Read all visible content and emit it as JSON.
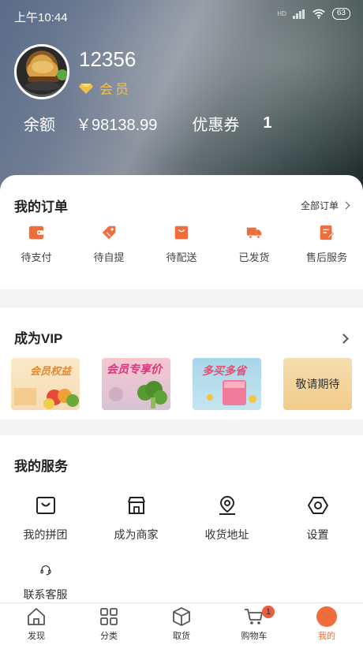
{
  "status_bar": {
    "time": "上午10:44",
    "battery": "63",
    "network": "HD"
  },
  "profile": {
    "username": "12356",
    "member_label": "会员"
  },
  "balance": {
    "label": "余额",
    "value": "￥98138.99",
    "coupon_label": "优惠券",
    "coupon_value": "1"
  },
  "orders": {
    "title": "我的订单",
    "all_label": "全部订单",
    "items": [
      {
        "label": "待支付",
        "icon": "wallet-icon"
      },
      {
        "label": "待自提",
        "icon": "tag-icon"
      },
      {
        "label": "待配送",
        "icon": "bag-icon"
      },
      {
        "label": "已发货",
        "icon": "truck-icon"
      },
      {
        "label": "售后服务",
        "icon": "document-edit-icon"
      }
    ]
  },
  "vip": {
    "title": "成为VIP",
    "cards": [
      {
        "label": "会员权益"
      },
      {
        "label": "会员专享价"
      },
      {
        "label": "多买多省"
      },
      {
        "label": "敬请期待"
      }
    ]
  },
  "services": {
    "title": "我的服务",
    "items": [
      {
        "label": "我的拼团",
        "icon": "group-buy-icon"
      },
      {
        "label": "成为商家",
        "icon": "store-icon"
      },
      {
        "label": "收货地址",
        "icon": "location-icon"
      },
      {
        "label": "设置",
        "icon": "gear-icon"
      },
      {
        "label": "联系客服",
        "icon": "headset-icon"
      }
    ]
  },
  "tabbar": {
    "items": [
      {
        "label": "发现"
      },
      {
        "label": "分类"
      },
      {
        "label": "取货"
      },
      {
        "label": "购物车",
        "badge": "1"
      },
      {
        "label": "我的"
      }
    ],
    "active_color": "#ef6c3b"
  },
  "colors": {
    "accent": "#ef6c3b",
    "gold": "#f0c146"
  }
}
